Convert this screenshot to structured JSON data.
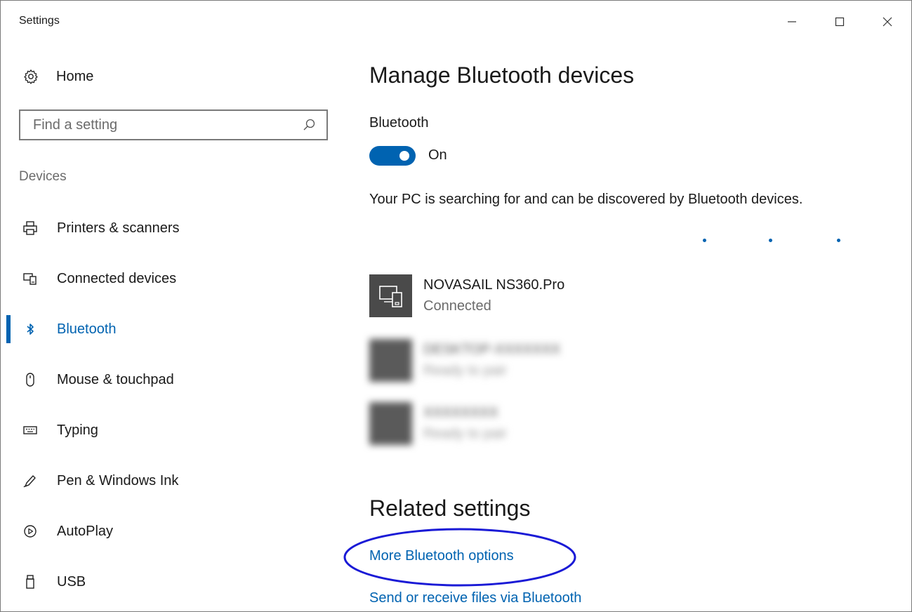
{
  "window": {
    "title": "Settings"
  },
  "sidebar": {
    "home_label": "Home",
    "search_placeholder": "Find a setting",
    "section_heading": "Devices",
    "items": [
      {
        "label": "Printers & scanners",
        "icon": "printer-icon"
      },
      {
        "label": "Connected devices",
        "icon": "connected-devices-icon"
      },
      {
        "label": "Bluetooth",
        "icon": "bluetooth-icon",
        "active": true
      },
      {
        "label": "Mouse & touchpad",
        "icon": "mouse-icon"
      },
      {
        "label": "Typing",
        "icon": "keyboard-icon"
      },
      {
        "label": "Pen & Windows Ink",
        "icon": "pen-icon"
      },
      {
        "label": "AutoPlay",
        "icon": "autoplay-icon"
      },
      {
        "label": "USB",
        "icon": "usb-icon"
      }
    ]
  },
  "main": {
    "title": "Manage Bluetooth devices",
    "bluetooth_label": "Bluetooth",
    "toggle_state": "On",
    "description": "Your PC is searching for and can be discovered by Bluetooth devices.",
    "devices": [
      {
        "name": "NOVASAIL NS360.Pro",
        "status": "Connected"
      },
      {
        "name": "DESKTOP-XXXXXXX",
        "status": "Ready to pair"
      },
      {
        "name": "XXXXXXXX",
        "status": "Ready to pair"
      }
    ],
    "related_title": "Related settings",
    "links": [
      "More Bluetooth options",
      "Send or receive files via Bluetooth"
    ]
  },
  "colors": {
    "accent": "#0063b1",
    "annotation": "#1a1ad6"
  }
}
